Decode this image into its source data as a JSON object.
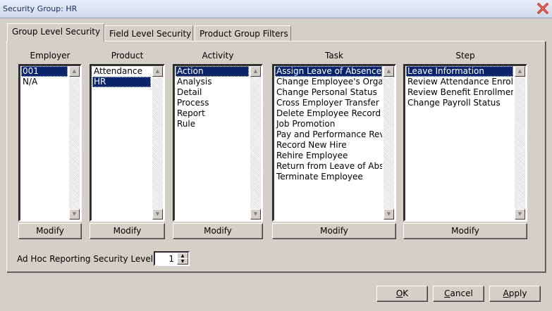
{
  "window": {
    "title": "Security Group: HR"
  },
  "tabs": [
    {
      "label": "Group Level Security"
    },
    {
      "label": "Field Level Security"
    },
    {
      "label": "Product Group Filters"
    }
  ],
  "columns": {
    "employer": {
      "header": "Employer",
      "items": [
        "001",
        "N/A"
      ],
      "selected": "001",
      "modify": "Modify"
    },
    "product": {
      "header": "Product",
      "items": [
        "Attendance",
        "HR"
      ],
      "selected": "HR",
      "modify": "Modify"
    },
    "activity": {
      "header": "Activity",
      "items": [
        "Action",
        "Analysis",
        "Detail",
        "Process",
        "Report",
        "Rule"
      ],
      "selected": "Action",
      "modify": "Modify"
    },
    "task": {
      "header": "Task",
      "items": [
        "Assign Leave of Absence",
        "Change Employee's Organi",
        "Change Personal Status",
        "Cross Employer Transfer",
        "Delete Employee Record",
        "Job Promotion",
        "Pay and Performance Revi",
        "Record New Hire",
        "Rehire Employee",
        "Return from Leave of Abse",
        "Terminate Employee"
      ],
      "selected": "Assign Leave of Absence",
      "modify": "Modify"
    },
    "step": {
      "header": "Step",
      "items": [
        "Leave Information",
        "Review Attendance Enrollm",
        "Review Benefit Enrollment",
        "Change Payroll Status"
      ],
      "selected": "Leave Information",
      "modify": "Modify"
    }
  },
  "adhoc": {
    "label": "Ad Hoc Reporting Security Level",
    "value": "1"
  },
  "footer": {
    "ok_first": "O",
    "ok_rest": "K",
    "cancel_first": "C",
    "cancel_rest": "ancel",
    "apply_first": "A",
    "apply_rest": "pply"
  },
  "colors": {
    "selection": "#0a246a",
    "dialog_bg": "#d4d0c8",
    "close_icon": "#d0342c"
  }
}
